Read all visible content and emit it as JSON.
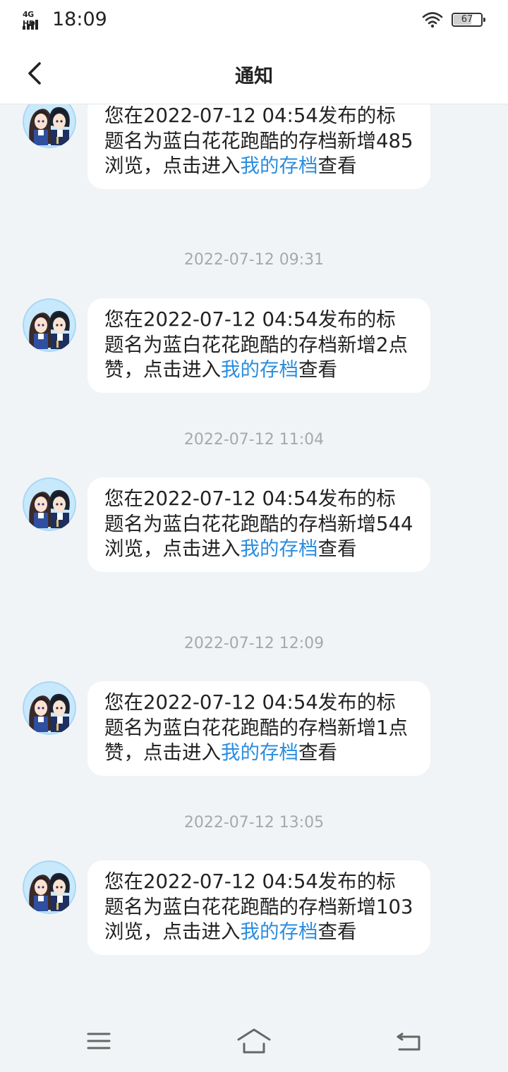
{
  "status_bar": {
    "network": "4G HD",
    "time": "18:09",
    "battery": "67",
    "battery_level": 0.67
  },
  "header": {
    "title": "通知",
    "back_icon": "chevron-left-icon"
  },
  "link_label": "我的存档",
  "messages": [
    {
      "text_before": "您在2022-07-12 04:54发布的标题名为蓝白花花跑酷的存档新增485浏览，点击进入",
      "link": "我的存档",
      "text_after": "查看"
    },
    {
      "time": "2022-07-12 09:31",
      "text_before": "您在2022-07-12 04:54发布的标题名为蓝白花花跑酷的存档新增2点赞，点击进入",
      "link": "我的存档",
      "text_after": "查看"
    },
    {
      "time": "2022-07-12 11:04",
      "text_before": "您在2022-07-12 04:54发布的标题名为蓝白花花跑酷的存档新增544浏览，点击进入",
      "link": "我的存档",
      "text_after": "查看"
    },
    {
      "time": "2022-07-12 12:09",
      "text_before": "您在2022-07-12 04:54发布的标题名为蓝白花花跑酷的存档新增1点赞，点击进入",
      "link": "我的存档",
      "text_after": "查看"
    },
    {
      "time": "2022-07-12 13:05",
      "text_before": "您在2022-07-12 04:54发布的标题名为蓝白花花跑酷的存档新增103浏览，点击进入",
      "link": "我的存档",
      "text_after": "查看"
    }
  ],
  "nav_bar": {
    "menu_icon": "menu-icon",
    "home_icon": "home-icon",
    "back_icon": "back-arrow-icon"
  },
  "colors": {
    "background": "#f1f4f6",
    "link": "#2a8de0",
    "timestamp": "#a8a8a8",
    "bubble": "#ffffff"
  }
}
